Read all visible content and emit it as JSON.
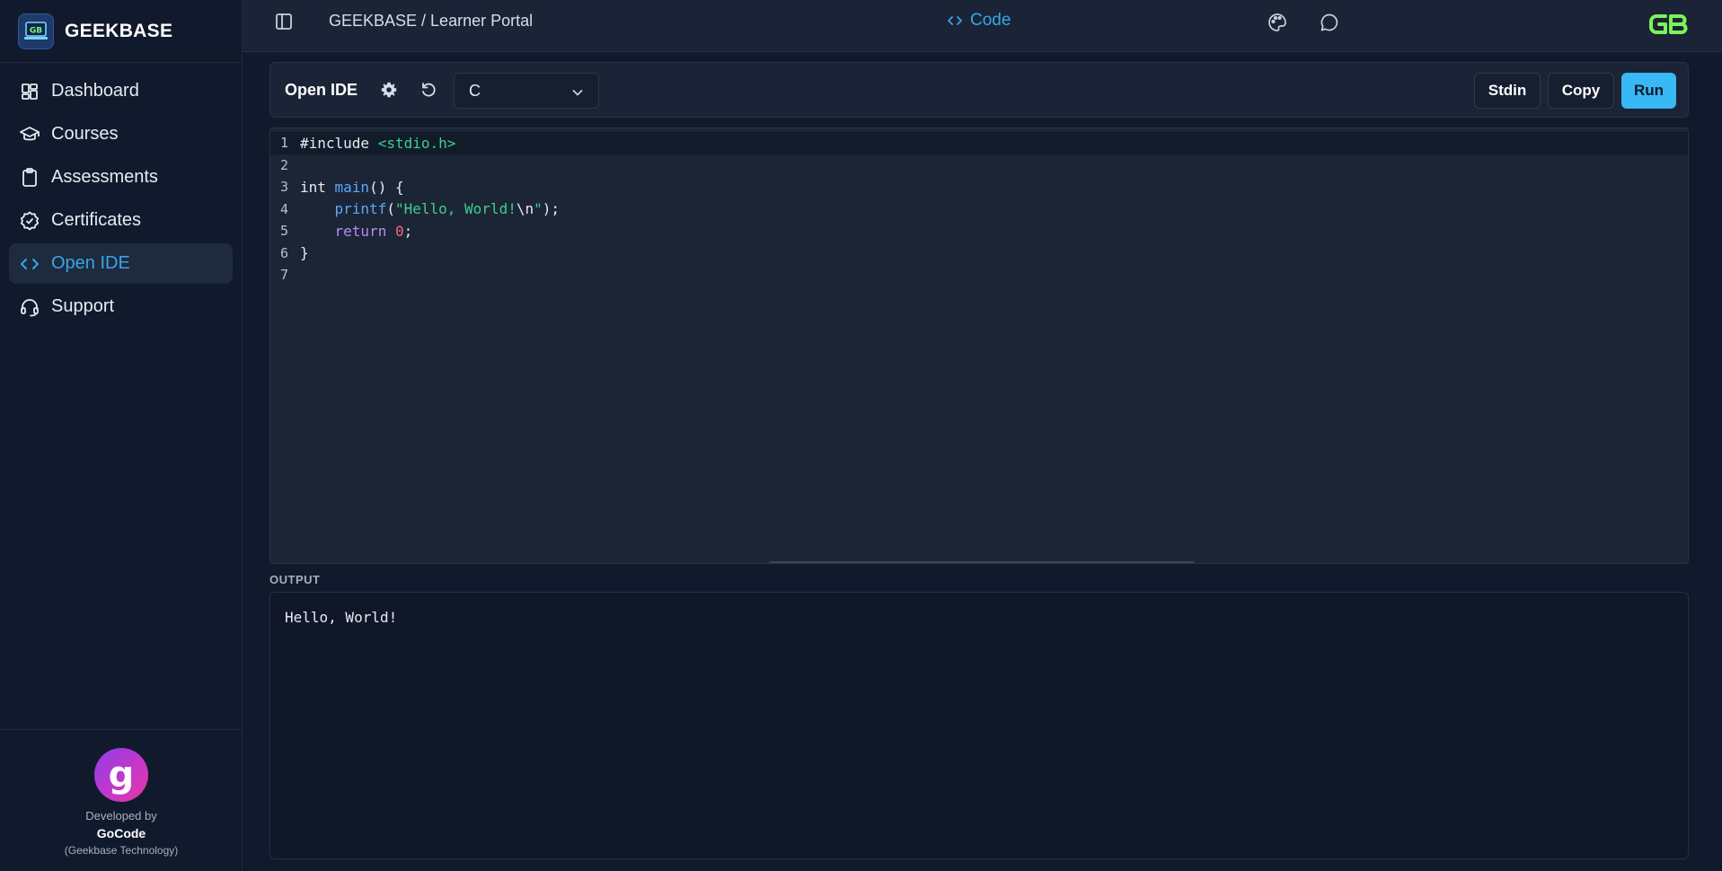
{
  "brand": {
    "name": "GEEKBASE",
    "logo_icon": "laptop-gb-logo-icon"
  },
  "sidebar": {
    "items": [
      {
        "label": "Dashboard",
        "icon": "dashboard-icon"
      },
      {
        "label": "Courses",
        "icon": "graduation-cap-icon"
      },
      {
        "label": "Assessments",
        "icon": "clipboard-icon"
      },
      {
        "label": "Certificates",
        "icon": "badge-check-icon"
      },
      {
        "label": "Open IDE",
        "icon": "code-icon",
        "active": true
      },
      {
        "label": "Support",
        "icon": "headset-icon"
      }
    ],
    "footer": {
      "developed_by": "Developed by",
      "developer": "GoCode",
      "organization": "(Geekbase Technology)"
    }
  },
  "topbar": {
    "breadcrumb": "GEEKBASE / Learner Portal",
    "center_tab": "Code",
    "icons": [
      "sidebar-toggle-icon",
      "palette-icon",
      "chat-icon",
      "gb-logo-icon"
    ]
  },
  "toolbar": {
    "title": "Open IDE",
    "language": "C",
    "buttons": {
      "stdin": "Stdin",
      "copy": "Copy",
      "run": "Run"
    }
  },
  "editor": {
    "lines": [
      {
        "n": "1",
        "tokens": [
          {
            "t": "#include ",
            "c": "plain"
          },
          {
            "t": "<stdio.h>",
            "c": "str"
          }
        ]
      },
      {
        "n": "2",
        "tokens": []
      },
      {
        "n": "3",
        "tokens": [
          {
            "t": "int ",
            "c": "plain"
          },
          {
            "t": "main",
            "c": "fn"
          },
          {
            "t": "() {",
            "c": "plain"
          }
        ]
      },
      {
        "n": "4",
        "tokens": [
          {
            "t": "    ",
            "c": "plain"
          },
          {
            "t": "printf",
            "c": "fn"
          },
          {
            "t": "(",
            "c": "plain"
          },
          {
            "t": "\"Hello, World!",
            "c": "str"
          },
          {
            "t": "\\n",
            "c": "plain"
          },
          {
            "t": "\"",
            "c": "str"
          },
          {
            "t": ");",
            "c": "plain"
          }
        ]
      },
      {
        "n": "5",
        "tokens": [
          {
            "t": "    ",
            "c": "plain"
          },
          {
            "t": "return",
            "c": "kw"
          },
          {
            "t": " ",
            "c": "plain"
          },
          {
            "t": "0",
            "c": "num"
          },
          {
            "t": ";",
            "c": "plain"
          }
        ]
      },
      {
        "n": "6",
        "tokens": [
          {
            "t": "}",
            "c": "plain"
          }
        ]
      },
      {
        "n": "7",
        "tokens": []
      }
    ]
  },
  "output": {
    "label": "OUTPUT",
    "text": "Hello, World!"
  },
  "colors": {
    "accent": "#38a6e8",
    "run_button": "#38b8f4",
    "background": "#111a2c"
  }
}
